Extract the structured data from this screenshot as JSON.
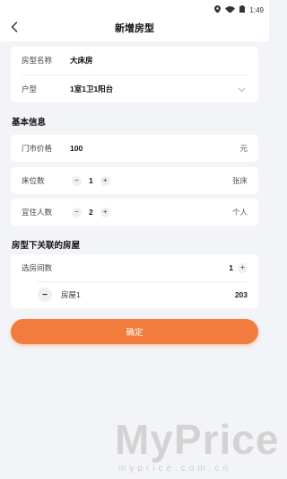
{
  "status": {
    "time": "1:49",
    "location_icon": "location-icon",
    "wifi_icon": "wifi-icon",
    "battery_icon": "battery-icon"
  },
  "nav": {
    "title": "新增房型",
    "back_icon": "back-arrow-icon"
  },
  "basic": {
    "name_label": "房型名称",
    "name_value": "大床房",
    "layout_label": "户型",
    "layout_value": "1室1卫1阳台",
    "layout_icon": "chevron-down-icon"
  },
  "info": {
    "section_title": "基本信息",
    "price_label": "门市价格",
    "price_value": "100",
    "price_unit": "元",
    "beds_label": "床位数",
    "beds_value": "1",
    "beds_unit": "张床",
    "people_label": "宜住人数",
    "people_value": "2",
    "people_unit": "个人",
    "minus": "−",
    "plus": "+"
  },
  "rooms": {
    "section_title": "房型下关联的房屋",
    "count_label": "选房间数",
    "count_value": "1",
    "add": "+",
    "items": [
      {
        "minus": "−",
        "name": "房屋1",
        "number": "203"
      }
    ]
  },
  "confirm_label": "确定",
  "watermark": {
    "big": "MyPrice",
    "small": "myprice.com.cn"
  },
  "colors": {
    "accent": "#f27c3d",
    "background": "#f3f4f8"
  }
}
